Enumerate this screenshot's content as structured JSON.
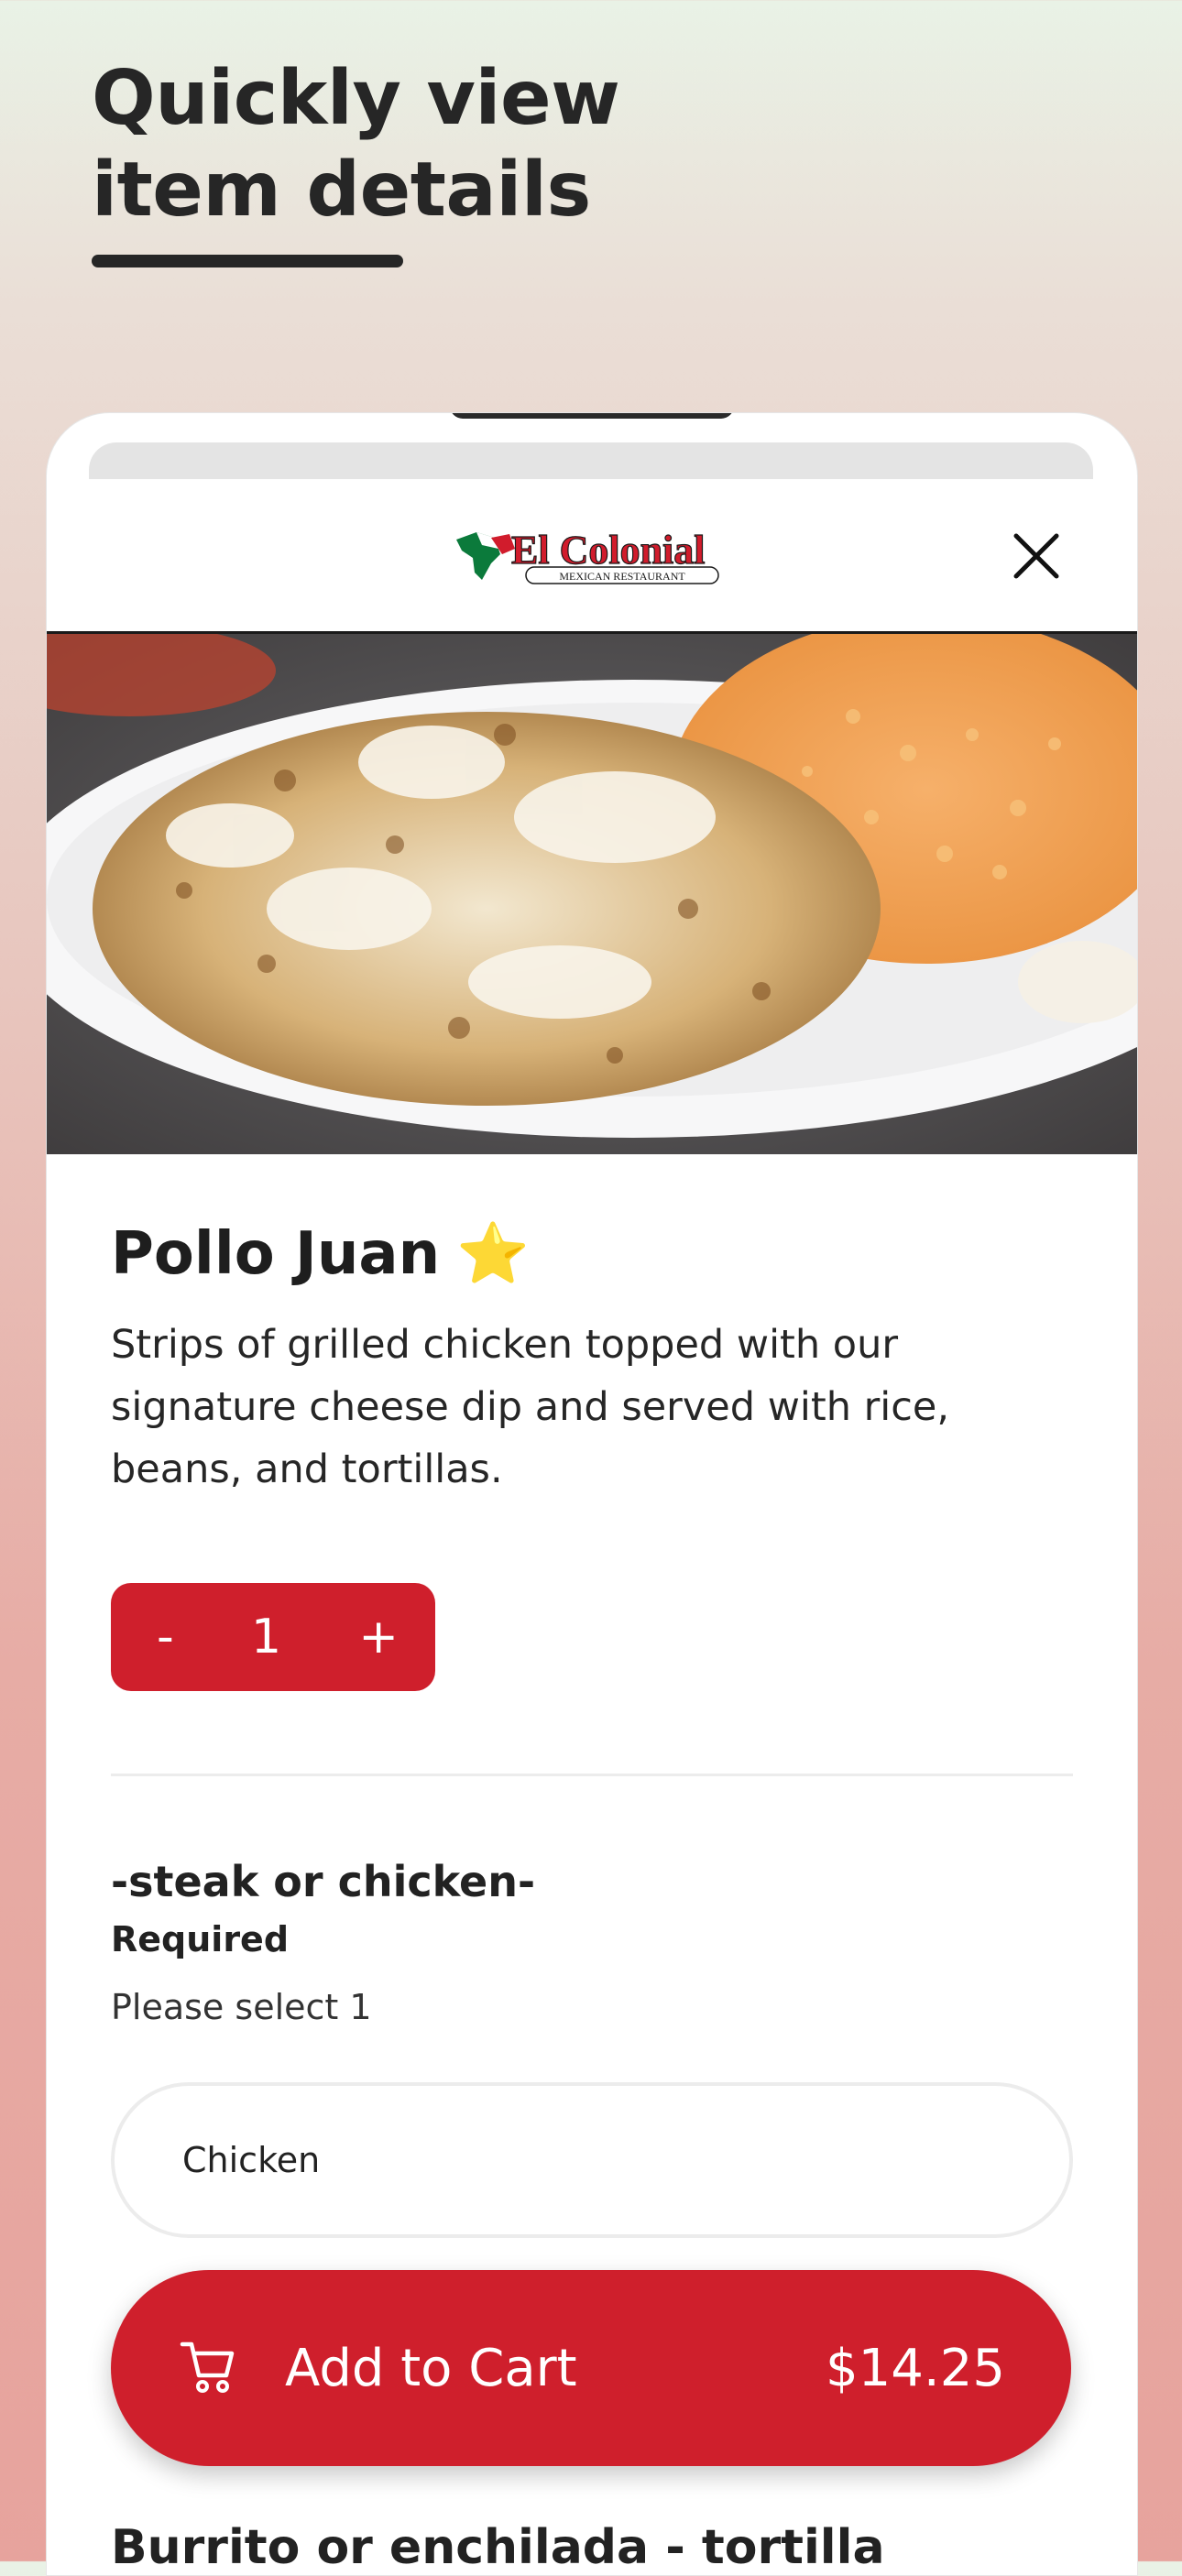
{
  "promo": {
    "headline": "Quickly view item details"
  },
  "brand": {
    "logo_text": "El Colonial",
    "logo_subtext": "MEXICAN RESTAURANT",
    "accent_color": "#cf1f2c"
  },
  "item": {
    "name": "Pollo Juan",
    "badge_emoji": "⭐",
    "description": "Strips of grilled chicken topped with our signature cheese dip and served with rice, beans, and tortillas."
  },
  "quantity": {
    "minus_label": "-",
    "value": "1",
    "plus_label": "+"
  },
  "options": {
    "section_title": "-steak or chicken-",
    "required_label": "Required",
    "helper_text": "Please select 1",
    "selected_option": "Chicken"
  },
  "next_section_partial": "Burrito or enchilada - tortilla",
  "cart": {
    "label": "Add to Cart",
    "price": "$14.25",
    "icon": "cart-icon"
  },
  "icons": {
    "close": "close-icon"
  }
}
